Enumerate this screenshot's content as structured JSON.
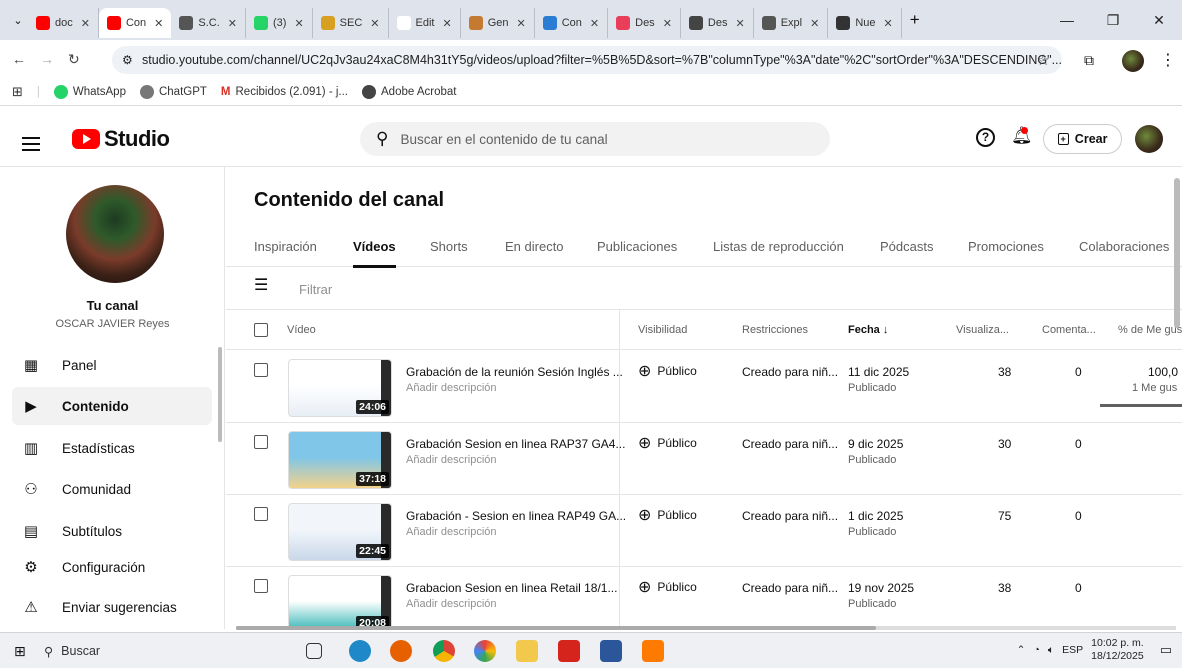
{
  "browser": {
    "tabs": [
      {
        "label": "doc",
        "fav": "#ff0000"
      },
      {
        "label": "Con",
        "fav": "#ff0000",
        "active": true
      },
      {
        "label": "S.C.",
        "fav": "#555555",
        "glyph": "W"
      },
      {
        "label": "(3)",
        "fav": "#25d366"
      },
      {
        "label": "SEC",
        "fav": "#d8a020"
      },
      {
        "label": "Edit",
        "fav": "#ffffff"
      },
      {
        "label": "Gen",
        "fav": "#c47a30"
      },
      {
        "label": "Con",
        "fav": "#2b7cd3"
      },
      {
        "label": "Des",
        "fav": "#e83e5a"
      },
      {
        "label": "Des",
        "fav": "#444444"
      },
      {
        "label": "Expl",
        "fav": "#555555"
      },
      {
        "label": "Nue",
        "fav": "#333333"
      }
    ],
    "url": "studio.youtube.com/channel/UC2qJv3au24xaC8M4h31tY5g/videos/upload?filter=%5B%5D&sort=%7B\"columnType\"%3A\"date\"%2C\"sortOrder\"%3A\"DESCENDING\"...",
    "bookmarks": [
      "WhatsApp",
      "ChatGPT",
      "Recibidos (2.091) - j...",
      "Adobe Acrobat"
    ]
  },
  "header": {
    "logo_text": "Studio",
    "search_placeholder": "Buscar en el contenido de tu canal",
    "create_label": "Crear"
  },
  "sidebar": {
    "channel_title": "Tu canal",
    "channel_name": "OSCAR JAVIER Reyes",
    "items": [
      {
        "label": "Panel",
        "icon": "dashboard-icon"
      },
      {
        "label": "Contenido",
        "icon": "content-icon",
        "active": true
      },
      {
        "label": "Estadísticas",
        "icon": "analytics-icon"
      },
      {
        "label": "Comunidad",
        "icon": "community-icon"
      },
      {
        "label": "Subtítulos",
        "icon": "subtitles-icon"
      },
      {
        "label": "Configuración",
        "icon": "settings-icon"
      },
      {
        "label": "Enviar sugerencias",
        "icon": "feedback-icon"
      }
    ]
  },
  "main": {
    "title": "Contenido del canal",
    "tabs": [
      "Inspiración",
      "Vídeos",
      "Shorts",
      "En directo",
      "Publicaciones",
      "Listas de reproducción",
      "Pódcasts",
      "Promociones",
      "Colaboraciones"
    ],
    "active_tab": "Vídeos",
    "filter_placeholder": "Filtrar",
    "columns": {
      "video": "Vídeo",
      "visibility": "Visibilidad",
      "restrictions": "Restricciones",
      "date": "Fecha",
      "views": "Visualiza...",
      "comments": "Comenta...",
      "likes": "% de Me gus"
    },
    "rows": [
      {
        "title": "Grabación de la reunión Sesión Inglés ...",
        "desc": "Añadir descripción",
        "duration": "24:06",
        "visibility": "Público",
        "restriction": "Creado para niñ...",
        "date": "11 dic 2025",
        "status": "Publicado",
        "views": "38",
        "comments": "0",
        "likes": "100,0",
        "likes_sub": "1 Me gus"
      },
      {
        "title": "Grabación Sesion en linea RAP37 GA4...",
        "desc": "Añadir descripción",
        "duration": "37:18",
        "visibility": "Público",
        "restriction": "Creado para niñ...",
        "date": "9 dic 2025",
        "status": "Publicado",
        "views": "30",
        "comments": "0",
        "likes": "",
        "likes_sub": ""
      },
      {
        "title": "Grabación - Sesion en linea RAP49 GA...",
        "desc": "Añadir descripción",
        "duration": "22:45",
        "visibility": "Público",
        "restriction": "Creado para niñ...",
        "date": "1 dic 2025",
        "status": "Publicado",
        "views": "75",
        "comments": "0",
        "likes": "",
        "likes_sub": ""
      },
      {
        "title": "Grabacion Sesion en linea Retail 18/1...",
        "desc": "Añadir descripción",
        "duration": "20:08",
        "visibility": "Público",
        "restriction": "Creado para niñ...",
        "date": "19 nov 2025",
        "status": "Publicado",
        "views": "38",
        "comments": "0",
        "likes": "",
        "likes_sub": ""
      }
    ]
  },
  "taskbar": {
    "search_label": "Buscar",
    "language": "ESP",
    "time": "10:02 p. m.",
    "date": "18/12/2025"
  },
  "colors": {
    "accent": "#ff0000",
    "tab_bar": "#dfe3eb"
  }
}
